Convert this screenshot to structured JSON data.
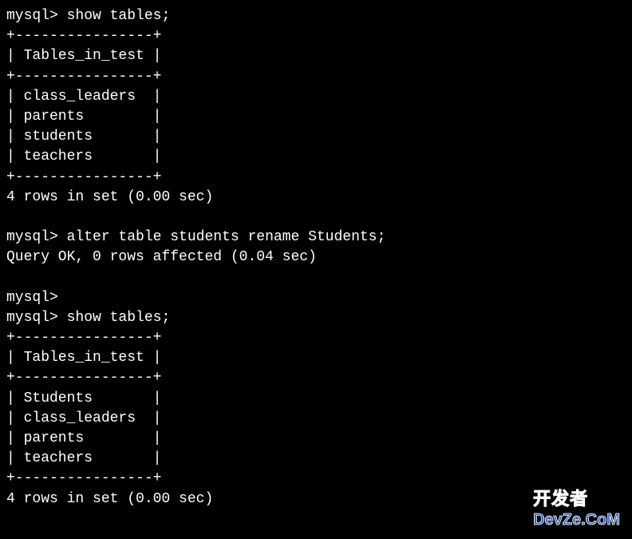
{
  "terminal": {
    "prompt": "mysql>",
    "commands": {
      "show_tables": "show tables;",
      "alter_table": "alter table students rename Students;"
    },
    "table1": {
      "border_top": "+----------------+",
      "header": "| Tables_in_test |",
      "rows": [
        "| class_leaders  |",
        "| parents        |",
        "| students       |",
        "| teachers       |"
      ]
    },
    "result1": "4 rows in set (0.00 sec)",
    "alter_result": "Query OK, 0 rows affected (0.04 sec)",
    "table2": {
      "border_top": "+----------------+",
      "header": "| Tables_in_test |",
      "rows": [
        "| Students       |",
        "| class_leaders  |",
        "| parents        |",
        "| teachers       |"
      ]
    },
    "result2": "4 rows in set (0.00 sec)"
  },
  "watermark": {
    "top": "开发者",
    "bottom": "DevZe.CoM"
  }
}
